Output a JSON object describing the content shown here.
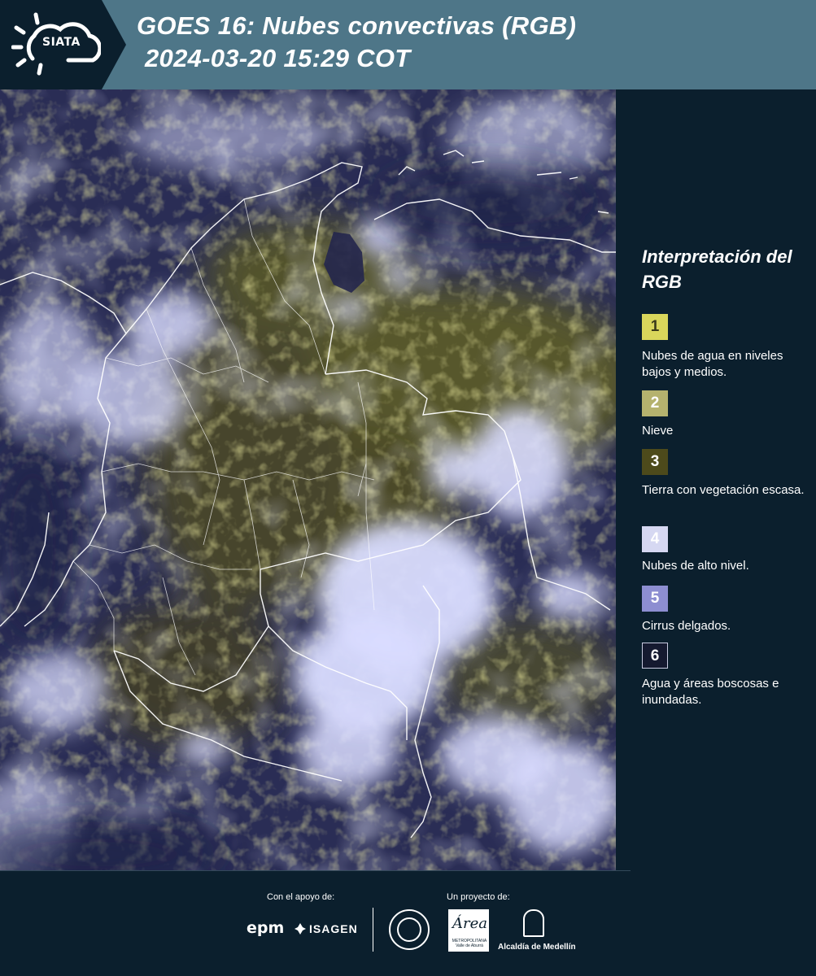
{
  "header": {
    "logo_text": "SIATA",
    "title_line1": "GOES 16: Nubes convectivas (RGB)",
    "title_line2": "2024-03-20 15:29 COT"
  },
  "legend": {
    "title": "Interpretación del RGB",
    "items": [
      {
        "number": "1",
        "label": "Nubes de agua en niveles bajos y medios.",
        "color": "#d9d65b"
      },
      {
        "number": "2",
        "label": "Nieve",
        "color": "#b5b26e"
      },
      {
        "number": "3",
        "label": "Tierra con vegetación escasa.",
        "color": "#4d4a1b"
      },
      {
        "number": "4",
        "label": "Nubes de alto nivel.",
        "color": "#d6d8f2"
      },
      {
        "number": "5",
        "label": "Cirrus delgados.",
        "color": "#8d8ed1"
      },
      {
        "number": "6",
        "label": "Agua y áreas boscosas e inundadas.",
        "color": "#151a30"
      }
    ]
  },
  "footer": {
    "support_label": "Con el apoyo de:",
    "project_label": "Un proyecto de:",
    "sponsor1": "epm",
    "sponsor2": "ISAGEN",
    "partner_area_logo": "Área",
    "partner_area_sub": "METROPOLITANA Valle de Aburrá",
    "partner_alcaldia": "Alcaldía de Medellín"
  },
  "colors": {
    "header_bg": "#4e7688",
    "panel_bg": "#0b1f2d"
  }
}
